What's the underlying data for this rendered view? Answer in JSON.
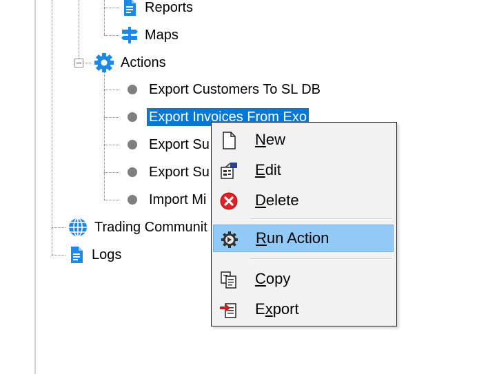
{
  "tree": {
    "reports": {
      "label": "Reports",
      "icon": "report-document-icon"
    },
    "maps": {
      "label": "Maps",
      "icon": "signpost-icon"
    },
    "actions": {
      "label": "Actions",
      "icon": "gear-icon",
      "children": [
        {
          "label": "Export Customers To SL DB"
        },
        {
          "label": "Export Invoices From Exo",
          "selected": true
        },
        {
          "label": "Export Su"
        },
        {
          "label": "Export Su"
        },
        {
          "label": "Import Mi"
        }
      ]
    },
    "trading": {
      "label": "Trading Communit",
      "icon": "globe-icon"
    },
    "logs": {
      "label": "Logs",
      "icon": "log-document-icon"
    }
  },
  "context_menu": {
    "items": [
      {
        "label": "New",
        "icon": "new-page-icon",
        "mnemonic": "N"
      },
      {
        "label": "Edit",
        "icon": "edit-properties-icon",
        "mnemonic": "E"
      },
      {
        "label": "Delete",
        "icon": "delete-x-icon",
        "mnemonic": "D"
      },
      {
        "label": "Run Action",
        "icon": "run-gear-icon",
        "mnemonic": "R",
        "highlighted": true
      },
      {
        "label": "Copy",
        "icon": "copy-icon",
        "mnemonic": "C"
      },
      {
        "label": "Export",
        "icon": "export-icon",
        "mnemonic": "x"
      }
    ]
  },
  "colors": {
    "selection": "#0078d7",
    "menu_highlight": "#91c9f7",
    "icon_blue": "#1e88e5"
  }
}
